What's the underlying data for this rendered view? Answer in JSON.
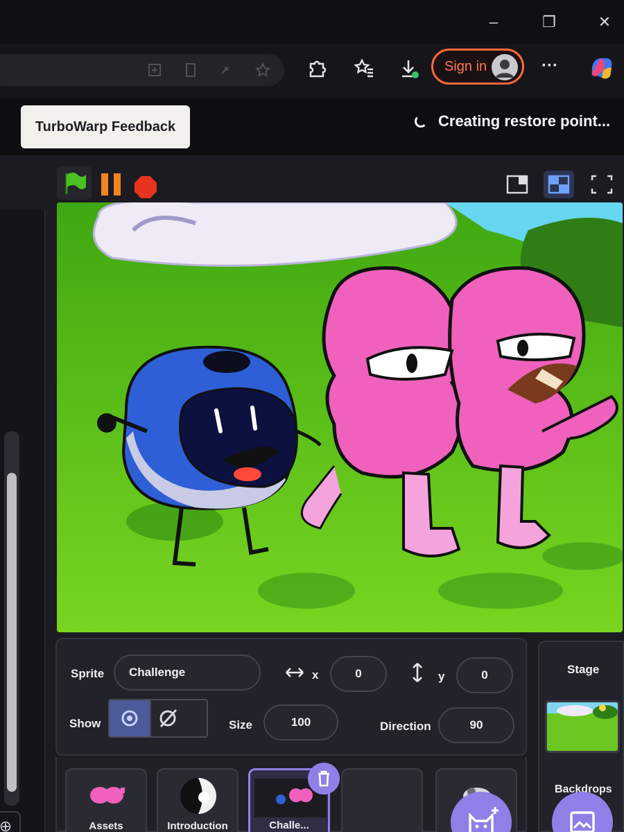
{
  "browser": {
    "window_controls": [
      "–",
      "❐",
      "✕"
    ],
    "sign_in_label": "Sign in",
    "more_label": "···",
    "accent": "#ff6a3c"
  },
  "bookmark_bar": {
    "feedback_label": "TurboWarp Feedback",
    "restore_status": "Creating restore point..."
  },
  "controls": {
    "green_flag": "green-flag-icon",
    "pause": "pause-icon",
    "stop": "stop-icon"
  },
  "sprite_info": {
    "sprite_label": "Sprite",
    "sprite_name": "Challenge",
    "x_label": "x",
    "x_value": "0",
    "y_label": "y",
    "y_value": "0",
    "show_label": "Show",
    "size_label": "Size",
    "size_value": "100",
    "direction_label": "Direction",
    "direction_value": "90"
  },
  "stage_panel": {
    "title": "Stage",
    "backdrops_label": "Backdrops"
  },
  "sprites": [
    {
      "name": "Assets"
    },
    {
      "name": "Introduction"
    },
    {
      "name": "Challe..."
    },
    {
      "name": ""
    },
    {
      "name": ""
    }
  ]
}
